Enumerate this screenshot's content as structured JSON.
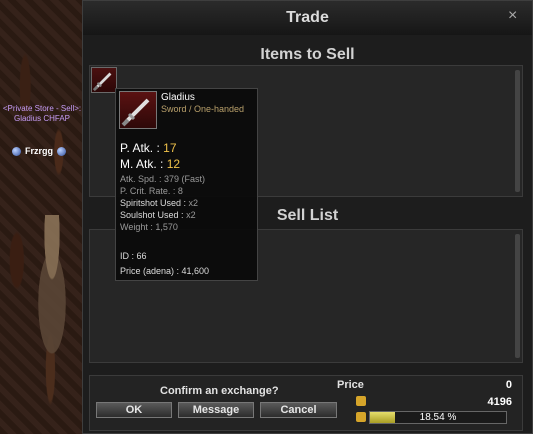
{
  "world": {
    "store_title": "<Private Store - Sell>: Gladius CHFAP",
    "player_name": "Frzrgg"
  },
  "dialog": {
    "title": "Trade",
    "close_icon": "×",
    "items_to_sell_title": "Items to Sell",
    "sell_list_title": "Sell List"
  },
  "tooltip": {
    "item_name": "Gladius",
    "item_type": "Sword / One-handed",
    "p_atk_label": "P. Atk. :",
    "p_atk_value": "17",
    "m_atk_label": "M. Atk. :",
    "m_atk_value": "12",
    "atk_spd": "Atk. Spd. : 379 (Fast)",
    "crit_rate": "P. Crit. Rate. : 8",
    "spiritshot_label": "Spiritshot Used :",
    "spiritshot_value": "x2",
    "soulshot_label": "Soulshot Used :",
    "soulshot_value": "x2",
    "weight": "Weight : 1,570",
    "id": "ID : 66",
    "price": "Price (adena) : 41,600"
  },
  "footer": {
    "confirm_label": "Confirm an exchange?",
    "ok_label": "OK",
    "message_label": "Message",
    "cancel_label": "Cancel",
    "price_label": "Price",
    "price_value": "0",
    "adena_value": "4196",
    "weight_percent_text": "18.54 %",
    "weight_fraction": 0.1854
  },
  "icons": {
    "close": "close-icon",
    "item": "sword-icon",
    "adena": "adena-icon",
    "weight": "weight-icon"
  },
  "colors": {
    "accent_gold": "#f0c24a",
    "store_title": "#c59bf5"
  }
}
